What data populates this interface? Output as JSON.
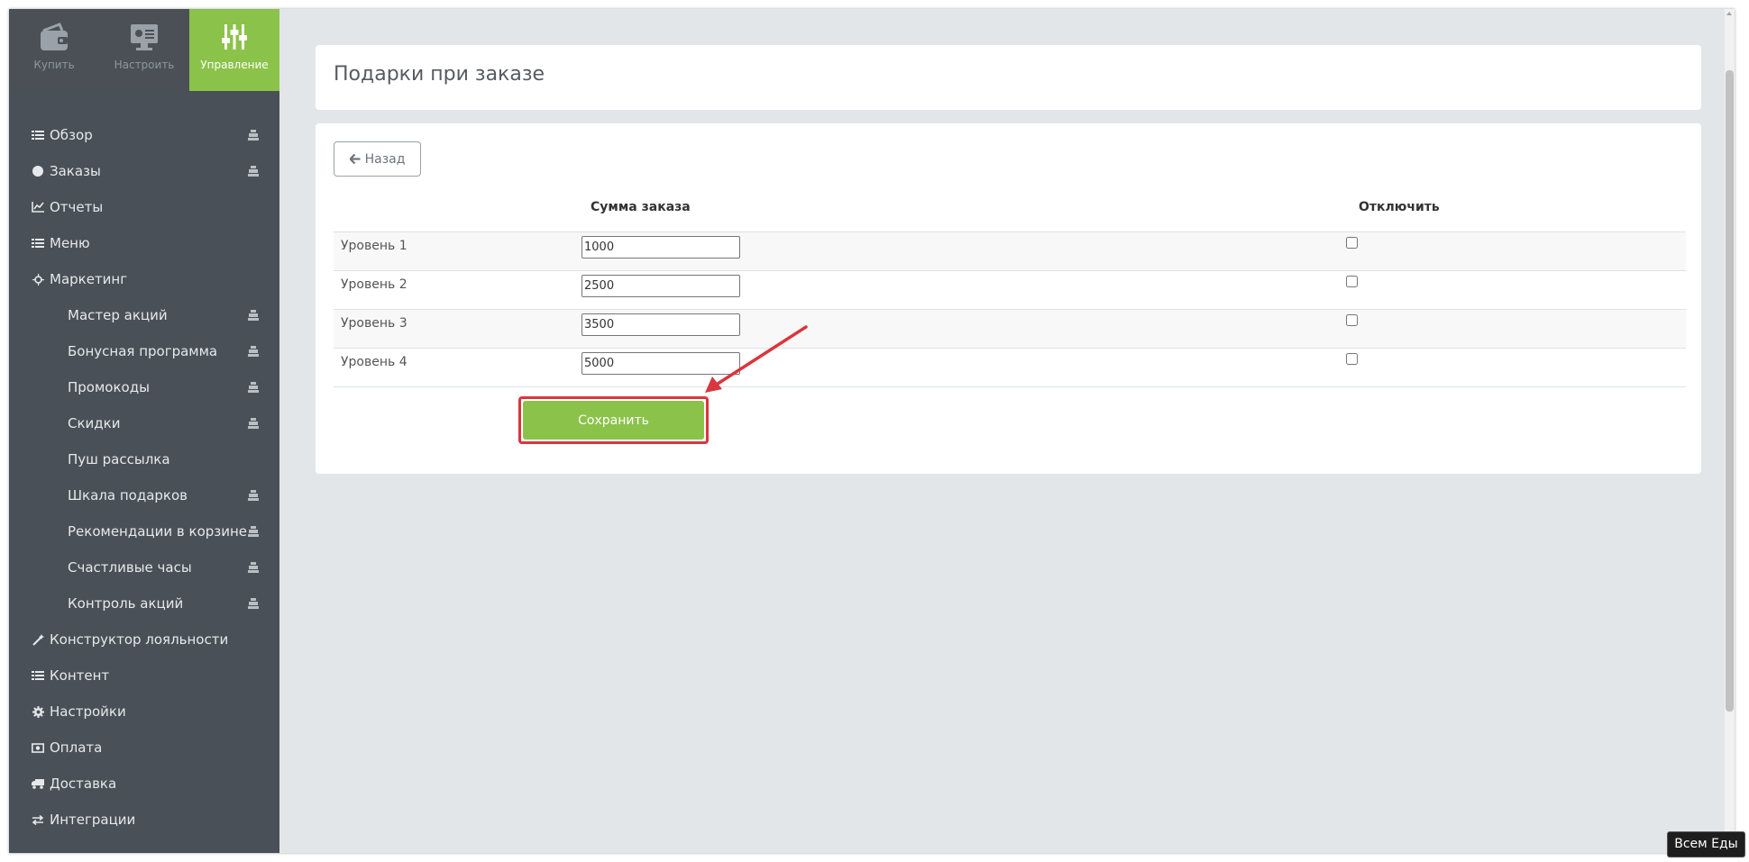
{
  "topnav": {
    "buy": "Купить",
    "configure": "Настроить",
    "manage": "Управление"
  },
  "sidebar": {
    "items": [
      {
        "label": "Обзор",
        "icon": "list-icon"
      },
      {
        "label": "Заказы",
        "icon": "circle-icon"
      },
      {
        "label": "Отчеты",
        "icon": "line-chart-icon"
      },
      {
        "label": "Меню",
        "icon": "list-icon"
      },
      {
        "label": "Маркетинг",
        "icon": "crosshair-icon"
      },
      {
        "label": "Мастер акций"
      },
      {
        "label": "Бонусная программа"
      },
      {
        "label": "Промокоды"
      },
      {
        "label": "Скидки"
      },
      {
        "label": "Пуш рассылка"
      },
      {
        "label": "Шкала подарков"
      },
      {
        "label": "Рекомендации в корзине"
      },
      {
        "label": "Счастливые часы"
      },
      {
        "label": "Контроль акций"
      },
      {
        "label": "Конструктор лояльности",
        "icon": "magic-wand-icon"
      },
      {
        "label": "Контент",
        "icon": "list-icon"
      },
      {
        "label": "Настройки",
        "icon": "gear-icon"
      },
      {
        "label": "Оплата",
        "icon": "money-icon"
      },
      {
        "label": "Доставка",
        "icon": "truck-icon"
      },
      {
        "label": "Интеграции",
        "icon": "exchange-icon"
      }
    ]
  },
  "page": {
    "title": "Подарки при заказе",
    "back": "Назад",
    "col_sum": "Сумма заказа",
    "col_disable": "Отключить",
    "rows": [
      {
        "label": "Уровень 1",
        "value": "1000"
      },
      {
        "label": "Уровень 2",
        "value": "2500"
      },
      {
        "label": "Уровень 3",
        "value": "3500"
      },
      {
        "label": "Уровень 4",
        "value": "5000"
      }
    ],
    "save": "Сохранить"
  },
  "badge": "Всем Еды",
  "colors": {
    "sidebar": "#495057",
    "accent": "#8bc34a",
    "highlight": "#d9363e",
    "background": "#e3e6e9"
  }
}
